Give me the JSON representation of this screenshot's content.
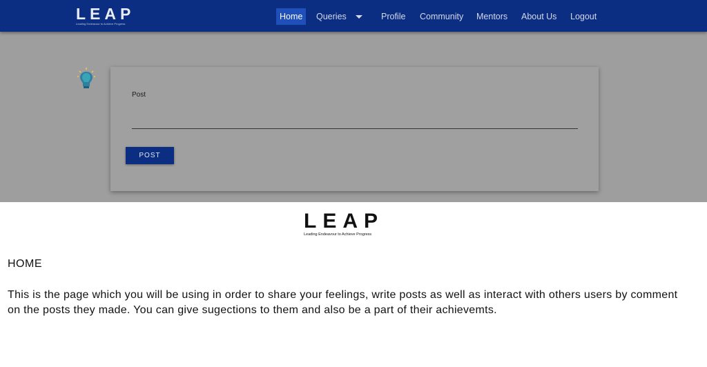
{
  "brand": {
    "name": "LEAP",
    "tagline": "Leading Endeavour to Achieve Progress"
  },
  "nav": {
    "items": [
      {
        "label": "Home",
        "active": true
      },
      {
        "label": "Queries",
        "active": false
      },
      {
        "label": "Profile",
        "active": false
      },
      {
        "label": "Community",
        "active": false
      },
      {
        "label": "Mentors",
        "active": false
      },
      {
        "label": "About Us",
        "active": false
      },
      {
        "label": "Logout",
        "active": false
      }
    ],
    "dropdown_icon": "caret-down-icon"
  },
  "post_form": {
    "label": "Post",
    "value": "",
    "button_label": "POST",
    "icon": "lightbulb-head-icon"
  },
  "doc_logo": {
    "name": "LEAP",
    "tagline": "Leading Endeavour to Achieve Progress"
  },
  "description": {
    "heading": "HOME",
    "body": "This is the page which you will be using in order to share your feelings, write posts as well as interact with others users by comment on the posts they made. You can give sugections to them and also be a part of their achievemts."
  },
  "colors": {
    "navbar": "#0b2d82",
    "active_nav": "#1f4fb8",
    "button": "#0b2d82",
    "background_overlay": "#9e9e9e"
  }
}
